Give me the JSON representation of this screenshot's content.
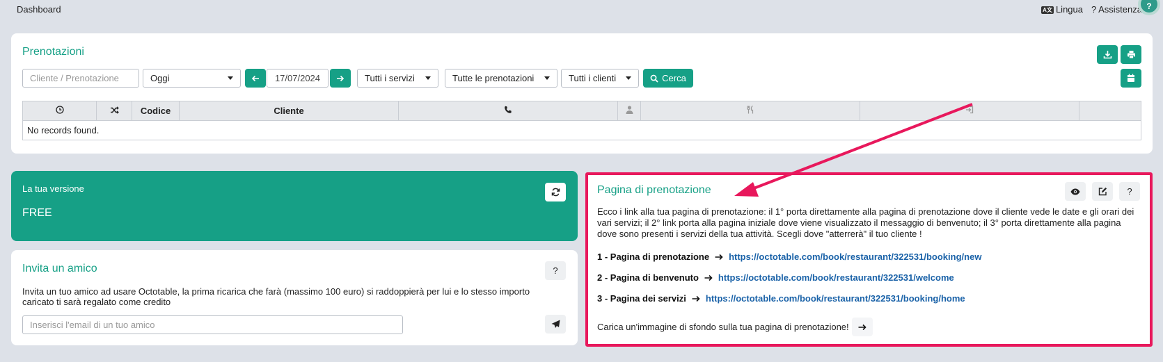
{
  "topbar": {
    "dashboard": "Dashboard",
    "lang_badge": "A文",
    "lingua": "Lingua",
    "assistenza": "? Assistenza",
    "help_bubble": "?"
  },
  "bookings": {
    "title": "Prenotazioni",
    "search_placeholder": "Cliente / Prenotazione",
    "period": "Oggi",
    "date": "17/07/2024",
    "services": "Tutti i servizi",
    "bookings_filter": "Tutte le prenotazioni",
    "clients": "Tutti i clienti",
    "search_label": "Cerca",
    "columns": [
      "",
      "",
      "Codice",
      "Cliente",
      "",
      "",
      "",
      "",
      ""
    ],
    "empty": "No records found."
  },
  "version": {
    "label": "La tua versione",
    "value": "FREE"
  },
  "invite": {
    "title": "Invita un amico",
    "help": "?",
    "text": "Invita un tuo amico ad usare Octotable, la prima ricarica che farà (massimo 100 euro) si raddoppierà per lui e lo stesso importo caricato ti sarà regalato come credito",
    "email_placeholder": "Inserisci l'email di un tuo amico"
  },
  "booking_page": {
    "title": "Pagina di prenotazione",
    "help": "?",
    "description": "Ecco i link alla tua pagina di prenotazione: il 1° porta direttamente alla pagina di prenotazione dove il cliente vede le date e gli orari dei vari servizi; il 2° link porta alla pagina iniziale dove viene visualizzato il messaggio di benvenuto; il 3° porta direttamente alla pagina dove sono presenti i servizi della tua attività. Scegli dove \"atterrerà\" il tuo cliente !",
    "links": [
      {
        "label": "1 - Pagina di prenotazione",
        "url": "https://octotable.com/book/restaurant/322531/booking/new"
      },
      {
        "label": "2 - Pagina di benvenuto",
        "url": "https://octotable.com/book/restaurant/322531/welcome"
      },
      {
        "label": "3 - Pagina dei servizi",
        "url": "https://octotable.com/book/restaurant/322531/booking/home"
      }
    ],
    "background_prompt": "Carica un'immagine di sfondo sulla tua pagina di prenotazione!"
  },
  "colors": {
    "accent": "#16a086",
    "annotation": "#e8185c",
    "link": "#1a62a8"
  }
}
